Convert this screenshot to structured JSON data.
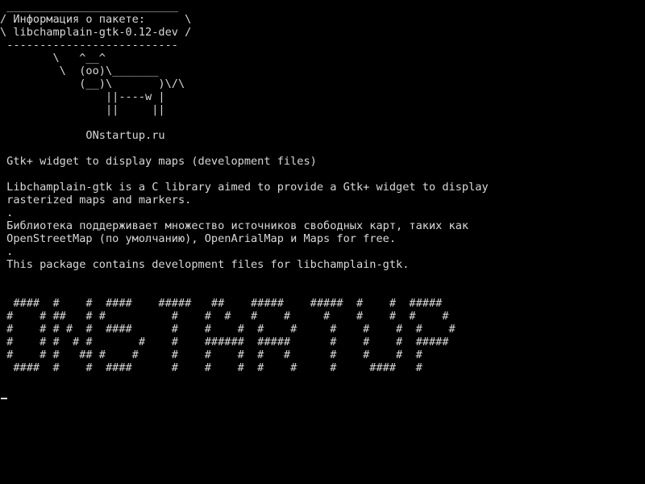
{
  "terminal": {
    "lines": [
      " __________________________",
      "/ Информация о пакете:      \\",
      "\\ libchamplain-gtk-0.12-dev /",
      " --------------------------",
      "        \\   ^__^",
      "         \\  (oo)\\_______",
      "            (__)\\       )\\/\\",
      "                ||----w |",
      "                ||     ||",
      "",
      "             ONstartup.ru",
      "",
      " Gtk+ widget to display maps (development files)",
      "",
      " Libchamplain-gtk is a C library aimed to provide a Gtk+ widget to display",
      " rasterized maps and markers.",
      " .",
      " Библиотека поддерживает множество источников свободных карт, таких как",
      " OpenStreetMap (по умолчанию), OpenArialMap и Maps for free.",
      " .",
      " This package contains development files for libchamplain-gtk.",
      "",
      "",
      "  ####  #    #  ####    #####   ##    #####    #####  #    #  #####",
      " #    # ##   # #          #    #  #   #    #     #    #    #  #    #",
      " #    # # #  #  ####      #    #    #  #    #     #    #    #  #    #",
      " #    # #  # #       #    #    ######  #####      #    #    #  #####",
      " #    # #   ## #    #     #    #    #  #   #      #    #    #  #",
      "  ####  #    #  ####      #    #    #  #    #     #     ####   #"
    ]
  }
}
